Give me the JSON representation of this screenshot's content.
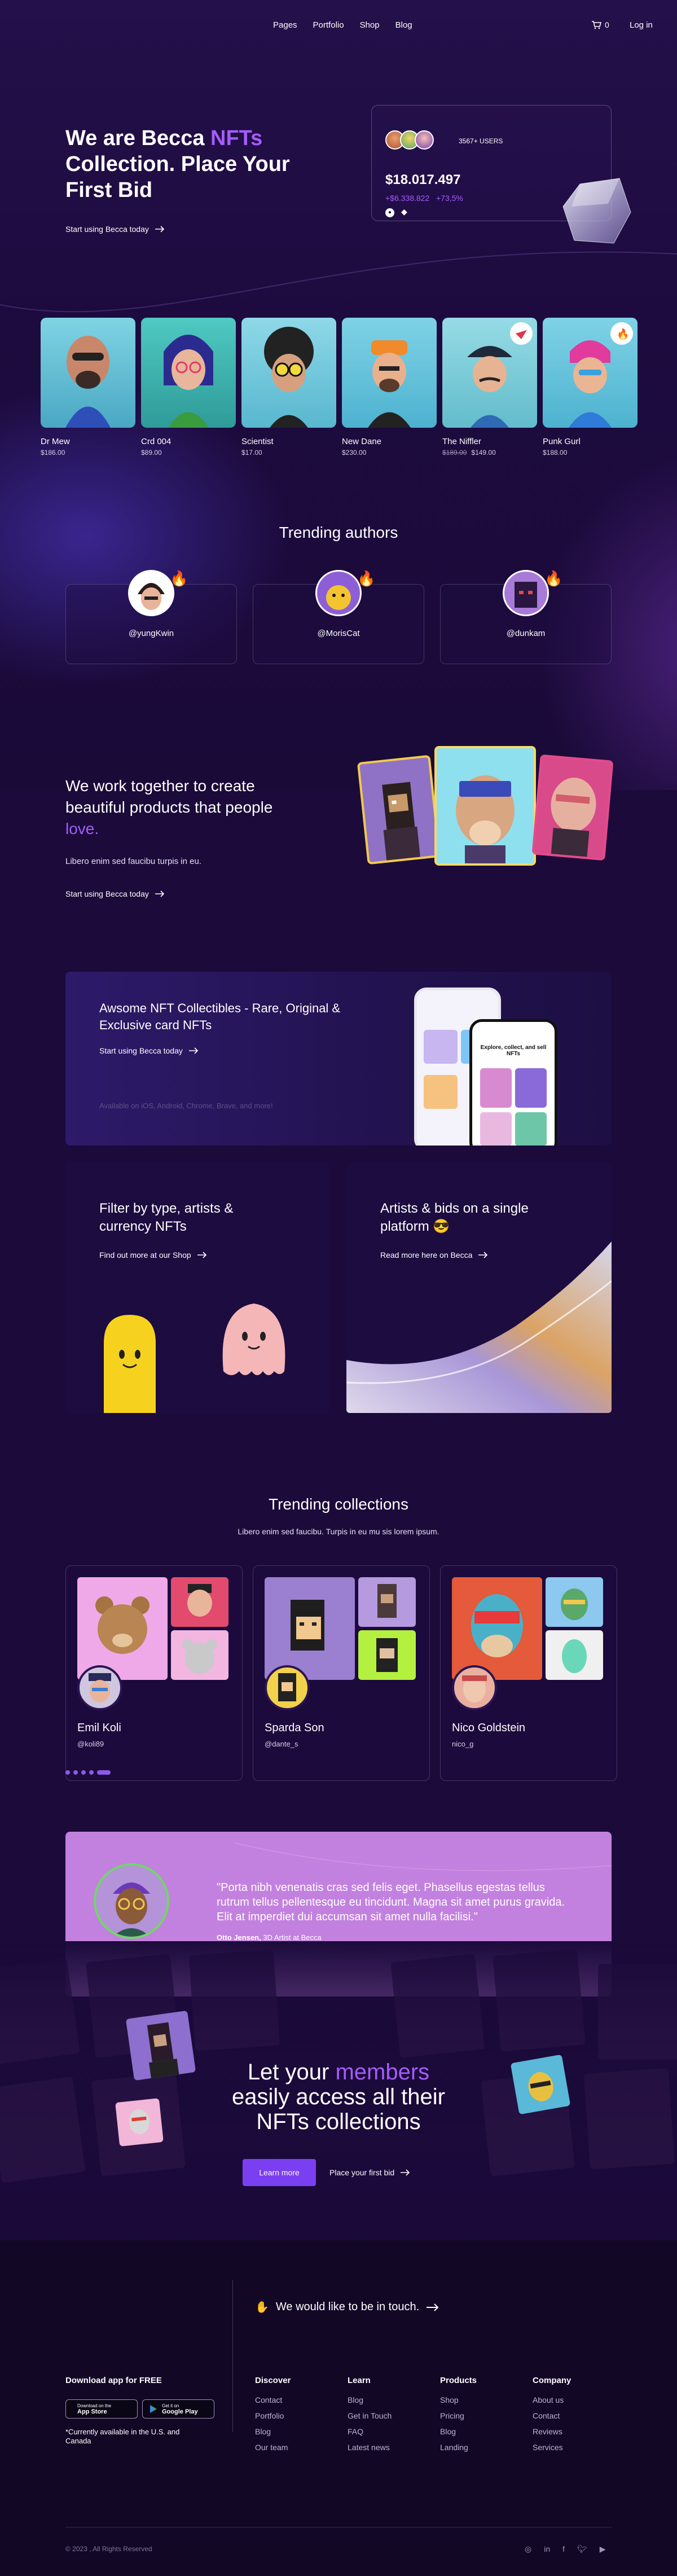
{
  "nav": {
    "links": [
      "Pages",
      "Portfolio",
      "Shop",
      "Blog"
    ],
    "cart_count": "0",
    "login": "Log in"
  },
  "hero": {
    "title_line1": "We are Becca ",
    "title_accent": "NFTs",
    "title_rest": "Collection. Place Your First Bid",
    "cta": "Start using Becca today"
  },
  "stats": {
    "users": "3567+ USERS",
    "amount": "$18.017.497",
    "change": "+$6.338.822",
    "percent": "+73,5%"
  },
  "nfts": [
    {
      "name": "Dr Mew",
      "price": "$186.00",
      "old_price": ""
    },
    {
      "name": "Crd 004",
      "price": "$89.00",
      "old_price": ""
    },
    {
      "name": "Scientist",
      "price": "$17.00",
      "old_price": ""
    },
    {
      "name": "New Dane",
      "price": "$230.00",
      "old_price": ""
    },
    {
      "name": "The Niffler",
      "price": "$149.00",
      "old_price": "$189.00"
    },
    {
      "name": "Punk Gurl",
      "price": "$188.00",
      "old_price": ""
    }
  ],
  "trending_authors": {
    "title": "Trending authors",
    "authors": [
      {
        "handle": "@yungKwin"
      },
      {
        "handle": "@MorisCat"
      },
      {
        "handle": "@dunkam"
      }
    ]
  },
  "together": {
    "title_main": "We work together to create beautiful products that people ",
    "title_accent": "love.",
    "text": "Libero enim sed faucibu turpis in eu.",
    "cta": "Start using Becca today"
  },
  "collectibles": {
    "title": "Awsome NFT Collectibles - Rare, Original & Exclusive card NFTs",
    "cta": "Start using Becca today",
    "note": "Available on iOS, Android, Chrome, Brave, and more!",
    "phone_text": "Explore, collect, and sell NFTs"
  },
  "filter_card": {
    "title": "Filter by type, artists & currency NFTs",
    "cta": "Find out more at our Shop"
  },
  "artists_card": {
    "title": "Artists & bids on a single platform 😎",
    "cta": "Read more here on Becca"
  },
  "trending_collections": {
    "title": "Trending collections",
    "subtitle": "Libero enim sed faucibu. Turpis in eu mu sis lorem ipsum.",
    "items": [
      {
        "name": "Emil Koli",
        "handle": "@koli89"
      },
      {
        "name": "Sparda Son",
        "handle": "@dante_s"
      },
      {
        "name": "Nico Goldstein",
        "handle": "nico_g"
      }
    ]
  },
  "testimonial": {
    "quote": "\"Porta nibh venenatis cras sed felis eget. Phasellus egestas tellus rutrum tellus pellentesque eu tincidunt. Magna sit amet purus gravida. Elit at imperdiet dui accumsan sit amet nulla facilisi.\"",
    "author": "Otto Jensen,",
    "role": "3D Artist at Becca"
  },
  "members": {
    "line1_pre": "Let your ",
    "line1_accent": "members",
    "line2": "easily access all their NFTs collections",
    "button": "Learn more",
    "link": "Place your first bid"
  },
  "footer": {
    "contact": "We would like to be in touch.",
    "download_title": "Download app for FREE",
    "appstore_small": "Download on the",
    "appstore": "App Store",
    "googleplay_small": "Get it on",
    "googleplay": "Google Play",
    "note": "*Currently available in the U.S. and Canada",
    "columns": [
      {
        "title": "Discover",
        "items": [
          "Contact",
          "Portfolio",
          "Blog",
          "Our team"
        ]
      },
      {
        "title": "Learn",
        "items": [
          "Blog",
          "Get in Touch",
          "FAQ",
          "Latest news"
        ]
      },
      {
        "title": "Products",
        "items": [
          "Shop",
          "Pricing",
          "Blog",
          "Landing"
        ]
      },
      {
        "title": "Company",
        "items": [
          "About us",
          "Contact",
          "Reviews",
          "Services"
        ]
      }
    ],
    "copyright": "© 2023 , All Rights Reserved",
    "social_icons": [
      "instagram-icon",
      "linkedin-icon",
      "facebook-icon",
      "twitter-icon",
      "youtube-icon"
    ]
  },
  "colors": {
    "accent": "#a45dfa",
    "background": "#1b0a3a",
    "button": "#7b3ff2",
    "testimonial": "#c281df"
  }
}
